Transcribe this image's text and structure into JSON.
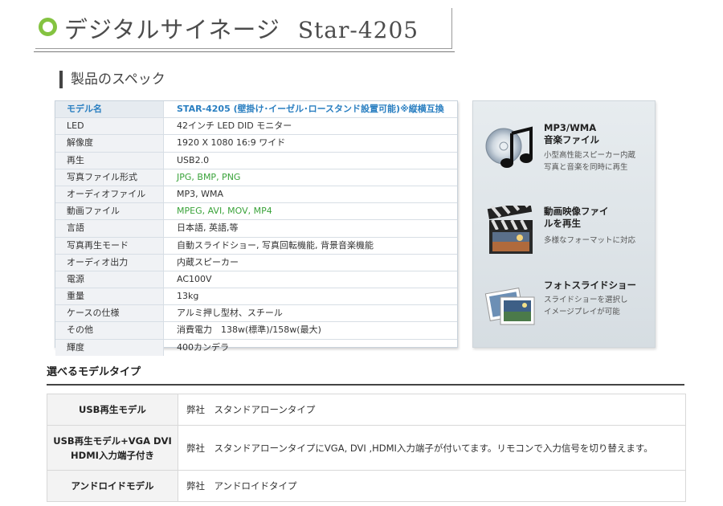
{
  "header": {
    "title": "デジタルサイネージ",
    "model": "Star-4205"
  },
  "specs": {
    "section_title": "製品のスペック",
    "rows": [
      {
        "key": "モデル名",
        "value": "STAR-4205 (壁掛け･イーゼル･ロースタンド設置可能)※縦横互換"
      },
      {
        "key": "LED",
        "value": "42インチ LED DID モニター"
      },
      {
        "key": "解像度",
        "value": "1920 X 1080 16:9 ワイド"
      },
      {
        "key": "再生",
        "value": "USB2.0"
      },
      {
        "key": "写真ファイル形式",
        "value": "JPG, BMP, PNG"
      },
      {
        "key": "オーディオファイル",
        "value": "MP3, WMA"
      },
      {
        "key": "動画ファイル",
        "value": "MPEG, AVI, MOV, MP4"
      },
      {
        "key": "言語",
        "value": "日本語, 英語,等"
      },
      {
        "key": "写真再生モード",
        "value": "自動スライドショー, 写真回転機能, 背景音楽機能"
      },
      {
        "key": "オーディオ出力",
        "value": "内蔵スピーカー"
      },
      {
        "key": "電源",
        "value": "AC100V"
      },
      {
        "key": "重量",
        "value": "13kg"
      },
      {
        "key": "ケースの仕様",
        "value": "アルミ押し型材、スチール"
      },
      {
        "key": "その他",
        "value": "消費電力　138w(標準)/158w(最大)"
      },
      {
        "key": "輝度",
        "value": "400カンデラ"
      }
    ]
  },
  "features": [
    {
      "icon": "music-note-icon",
      "title": "MP3/WMA\n音楽ファイル",
      "desc": "小型高性能スピーカー内蔵\n写真と音楽を同時に再生"
    },
    {
      "icon": "clapperboard-icon",
      "title": "動画映像ファイ\nルを再生",
      "desc": "多様なフォーマットに対応"
    },
    {
      "icon": "photo-stack-icon",
      "title": "フォトスライドショー",
      "desc": "スライドショーを選択し\nイメージプレイが可能"
    }
  ],
  "models": {
    "heading": "選べるモデルタイプ",
    "rows": [
      {
        "name": "USB再生モデル",
        "desc": "弊社　スタンドアローンタイプ"
      },
      {
        "name": "USB再生モデル+VGA DVI\nHDMI入力端子付き",
        "desc": "弊社　スタンドアローンタイプにVGA, DVI ,HDMI入力端子が付いてます。リモコンで入力信号を切り替えます。"
      },
      {
        "name": "アンドロイドモデル",
        "desc": "弊社　アンドロイドタイプ"
      }
    ]
  },
  "colors": {
    "accent_green": "#84c341",
    "header_blue": "#2a7fc1",
    "value_green": "#3aa33a"
  }
}
